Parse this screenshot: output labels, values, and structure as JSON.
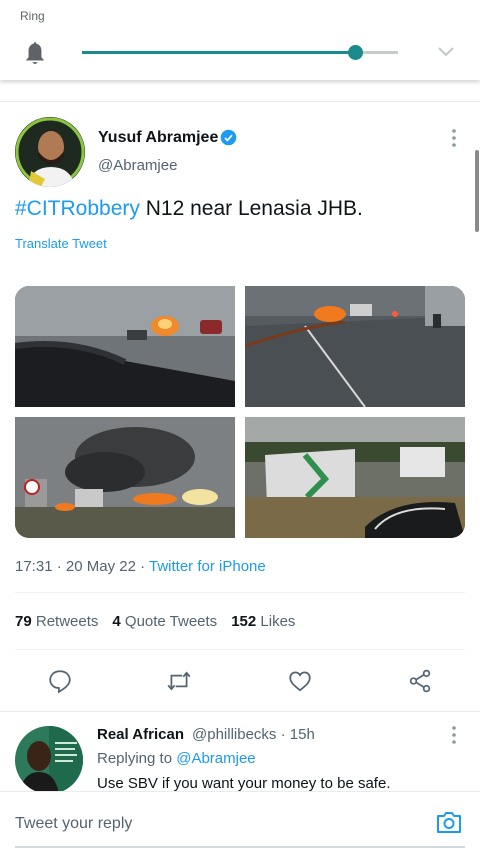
{
  "volume_panel": {
    "label": "Ring",
    "level": 0.86,
    "accent_color": "#1b8a8a",
    "icons": [
      "bell-icon",
      "chevron-down-icon"
    ]
  },
  "tweet": {
    "author_name": "Yusuf Abramjee",
    "author_handle": "@Abramjee",
    "verified": true,
    "hashtag": "#CITRobbery",
    "text_rest": " N12 near Lenasia JHB.",
    "translate_label": "Translate Tweet",
    "time": "17:31",
    "date": "20 May 22",
    "source": "Twitter for iPhone",
    "retweets_count": "79",
    "retweets_label": "Retweets",
    "quote_count": "4",
    "quote_label": "Quote Tweets",
    "likes_count": "152",
    "likes_label": "Likes",
    "accent_color": "#1d9bf0"
  },
  "actions": [
    "reply-icon",
    "retweet-icon",
    "like-icon",
    "share-icon"
  ],
  "reply": {
    "name": "Real African",
    "handle_time": "@phillibecks · 15h",
    "replying_prefix": "Replying to ",
    "replying_to": "@Abramjee",
    "text": "Use SBV if you want your money to be safe."
  },
  "composer": {
    "placeholder": "Tweet your reply"
  }
}
